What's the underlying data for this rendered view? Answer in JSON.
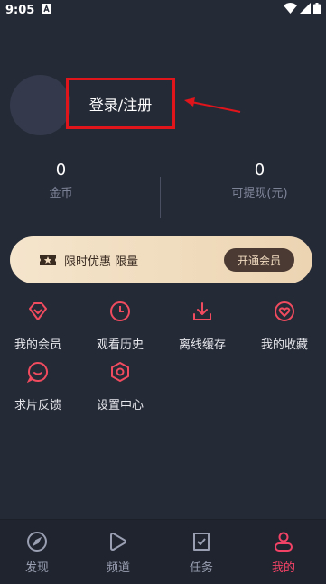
{
  "status_bar": {
    "time": "9:05",
    "notification_icon": "a-letter-icon",
    "right_icons": [
      "wifi-icon",
      "signal-icon",
      "battery-icon"
    ]
  },
  "profile": {
    "login_label": "登录/注册",
    "highlight_color": "#e0141b"
  },
  "stats": {
    "coins_value": "0",
    "coins_label": "金币",
    "cash_value": "0",
    "cash_label": "可提现(元)"
  },
  "promo": {
    "text": "限时优惠 限量",
    "button_label": "开通会员"
  },
  "menu": {
    "items": [
      {
        "label": "我的会员",
        "icon": "vip-diamond-icon"
      },
      {
        "label": "观看历史",
        "icon": "clock-icon"
      },
      {
        "label": "离线缓存",
        "icon": "download-icon"
      },
      {
        "label": "我的收藏",
        "icon": "heart-icon"
      },
      {
        "label": "求片反馈",
        "icon": "feedback-icon"
      },
      {
        "label": "设置中心",
        "icon": "settings-icon"
      }
    ],
    "icon_color": "#f04b5e"
  },
  "bottom_nav": {
    "items": [
      {
        "label": "发现",
        "icon": "compass-icon"
      },
      {
        "label": "频道",
        "icon": "play-icon"
      },
      {
        "label": "任务",
        "icon": "task-icon"
      },
      {
        "label": "我的",
        "icon": "user-icon"
      }
    ],
    "active": "我的",
    "active_color": "#f24366"
  }
}
